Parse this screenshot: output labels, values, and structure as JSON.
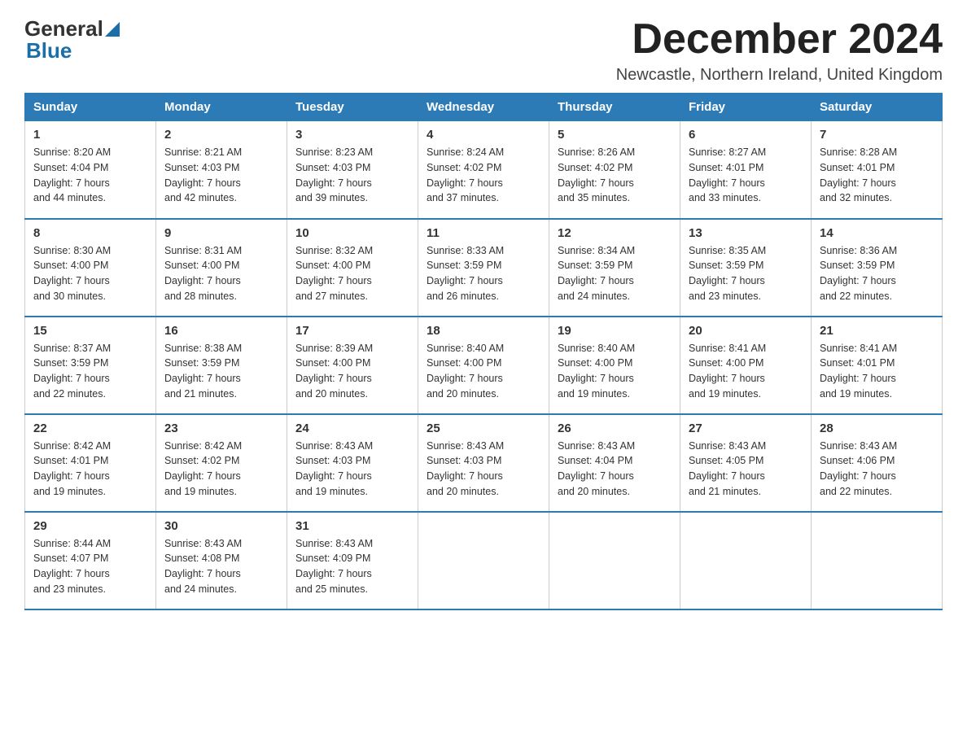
{
  "header": {
    "logo_general": "General",
    "logo_blue": "Blue",
    "title": "December 2024",
    "location": "Newcastle, Northern Ireland, United Kingdom"
  },
  "days_of_week": [
    "Sunday",
    "Monday",
    "Tuesday",
    "Wednesday",
    "Thursday",
    "Friday",
    "Saturday"
  ],
  "weeks": [
    [
      {
        "day": "1",
        "sunrise": "8:20 AM",
        "sunset": "4:04 PM",
        "daylight": "7 hours and 44 minutes."
      },
      {
        "day": "2",
        "sunrise": "8:21 AM",
        "sunset": "4:03 PM",
        "daylight": "7 hours and 42 minutes."
      },
      {
        "day": "3",
        "sunrise": "8:23 AM",
        "sunset": "4:03 PM",
        "daylight": "7 hours and 39 minutes."
      },
      {
        "day": "4",
        "sunrise": "8:24 AM",
        "sunset": "4:02 PM",
        "daylight": "7 hours and 37 minutes."
      },
      {
        "day": "5",
        "sunrise": "8:26 AM",
        "sunset": "4:02 PM",
        "daylight": "7 hours and 35 minutes."
      },
      {
        "day": "6",
        "sunrise": "8:27 AM",
        "sunset": "4:01 PM",
        "daylight": "7 hours and 33 minutes."
      },
      {
        "day": "7",
        "sunrise": "8:28 AM",
        "sunset": "4:01 PM",
        "daylight": "7 hours and 32 minutes."
      }
    ],
    [
      {
        "day": "8",
        "sunrise": "8:30 AM",
        "sunset": "4:00 PM",
        "daylight": "7 hours and 30 minutes."
      },
      {
        "day": "9",
        "sunrise": "8:31 AM",
        "sunset": "4:00 PM",
        "daylight": "7 hours and 28 minutes."
      },
      {
        "day": "10",
        "sunrise": "8:32 AM",
        "sunset": "4:00 PM",
        "daylight": "7 hours and 27 minutes."
      },
      {
        "day": "11",
        "sunrise": "8:33 AM",
        "sunset": "3:59 PM",
        "daylight": "7 hours and 26 minutes."
      },
      {
        "day": "12",
        "sunrise": "8:34 AM",
        "sunset": "3:59 PM",
        "daylight": "7 hours and 24 minutes."
      },
      {
        "day": "13",
        "sunrise": "8:35 AM",
        "sunset": "3:59 PM",
        "daylight": "7 hours and 23 minutes."
      },
      {
        "day": "14",
        "sunrise": "8:36 AM",
        "sunset": "3:59 PM",
        "daylight": "7 hours and 22 minutes."
      }
    ],
    [
      {
        "day": "15",
        "sunrise": "8:37 AM",
        "sunset": "3:59 PM",
        "daylight": "7 hours and 22 minutes."
      },
      {
        "day": "16",
        "sunrise": "8:38 AM",
        "sunset": "3:59 PM",
        "daylight": "7 hours and 21 minutes."
      },
      {
        "day": "17",
        "sunrise": "8:39 AM",
        "sunset": "4:00 PM",
        "daylight": "7 hours and 20 minutes."
      },
      {
        "day": "18",
        "sunrise": "8:40 AM",
        "sunset": "4:00 PM",
        "daylight": "7 hours and 20 minutes."
      },
      {
        "day": "19",
        "sunrise": "8:40 AM",
        "sunset": "4:00 PM",
        "daylight": "7 hours and 19 minutes."
      },
      {
        "day": "20",
        "sunrise": "8:41 AM",
        "sunset": "4:00 PM",
        "daylight": "7 hours and 19 minutes."
      },
      {
        "day": "21",
        "sunrise": "8:41 AM",
        "sunset": "4:01 PM",
        "daylight": "7 hours and 19 minutes."
      }
    ],
    [
      {
        "day": "22",
        "sunrise": "8:42 AM",
        "sunset": "4:01 PM",
        "daylight": "7 hours and 19 minutes."
      },
      {
        "day": "23",
        "sunrise": "8:42 AM",
        "sunset": "4:02 PM",
        "daylight": "7 hours and 19 minutes."
      },
      {
        "day": "24",
        "sunrise": "8:43 AM",
        "sunset": "4:03 PM",
        "daylight": "7 hours and 19 minutes."
      },
      {
        "day": "25",
        "sunrise": "8:43 AM",
        "sunset": "4:03 PM",
        "daylight": "7 hours and 20 minutes."
      },
      {
        "day": "26",
        "sunrise": "8:43 AM",
        "sunset": "4:04 PM",
        "daylight": "7 hours and 20 minutes."
      },
      {
        "day": "27",
        "sunrise": "8:43 AM",
        "sunset": "4:05 PM",
        "daylight": "7 hours and 21 minutes."
      },
      {
        "day": "28",
        "sunrise": "8:43 AM",
        "sunset": "4:06 PM",
        "daylight": "7 hours and 22 minutes."
      }
    ],
    [
      {
        "day": "29",
        "sunrise": "8:44 AM",
        "sunset": "4:07 PM",
        "daylight": "7 hours and 23 minutes."
      },
      {
        "day": "30",
        "sunrise": "8:43 AM",
        "sunset": "4:08 PM",
        "daylight": "7 hours and 24 minutes."
      },
      {
        "day": "31",
        "sunrise": "8:43 AM",
        "sunset": "4:09 PM",
        "daylight": "7 hours and 25 minutes."
      },
      null,
      null,
      null,
      null
    ]
  ],
  "labels": {
    "sunrise": "Sunrise:",
    "sunset": "Sunset:",
    "daylight": "Daylight:"
  }
}
